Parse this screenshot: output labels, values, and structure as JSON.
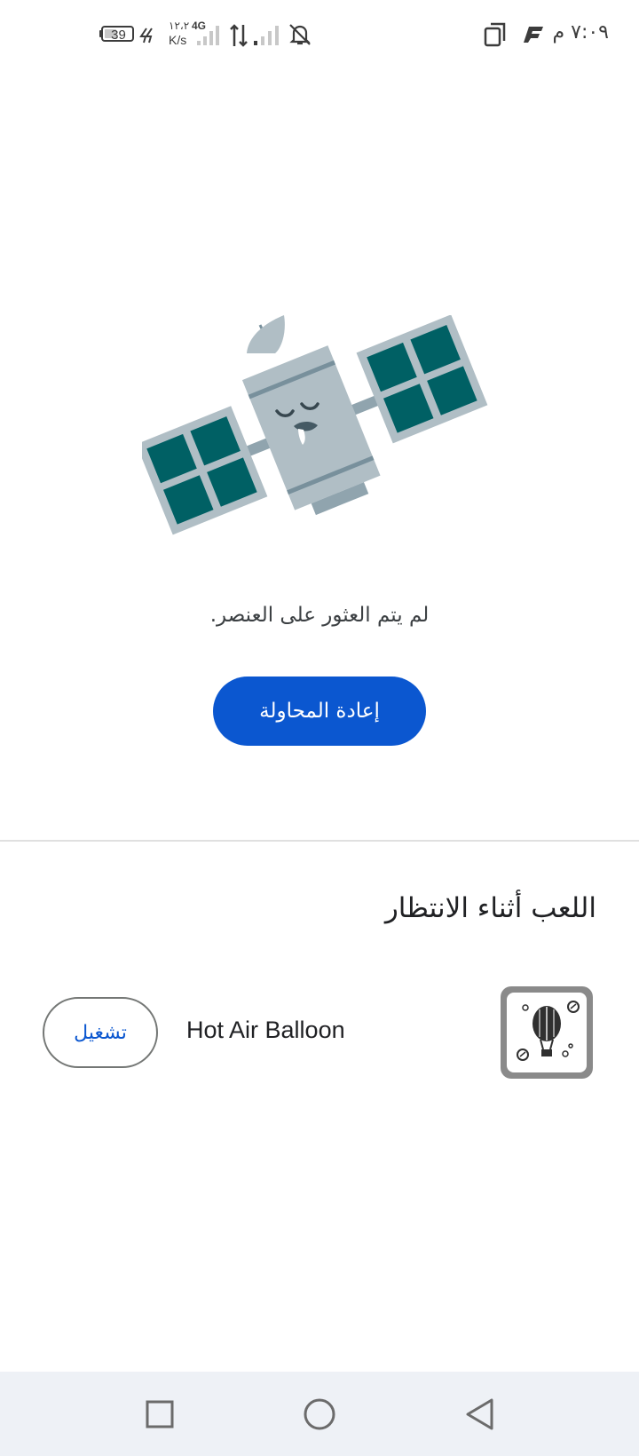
{
  "status_bar": {
    "battery_level": "39",
    "network_speed_value": "١٢،٢",
    "network_speed_unit": "K/s",
    "network_type": "4G",
    "time": "٧:٠٩ م"
  },
  "empty_state": {
    "message": "لم يتم العثور على العنصر.",
    "retry_label": "إعادة المحاولة"
  },
  "games": {
    "section_title": "اللعب أثناء الانتظار",
    "items": [
      {
        "name": "Hot Air Balloon",
        "play_label": "تشغيل"
      }
    ]
  },
  "colors": {
    "primary": "#0b57d0",
    "satellite_body": "#b0bec5",
    "satellite_panel": "#006064",
    "nav_background": "#eef1f6"
  },
  "icons": {
    "status_bar": [
      "battery-icon",
      "charging-icon",
      "signal-icon",
      "data-arrows-icon",
      "signal-icon",
      "notifications-off-icon",
      "copy-icon",
      "app-f-icon"
    ],
    "nav_bar": [
      "recents-icon",
      "home-icon",
      "back-icon"
    ]
  }
}
